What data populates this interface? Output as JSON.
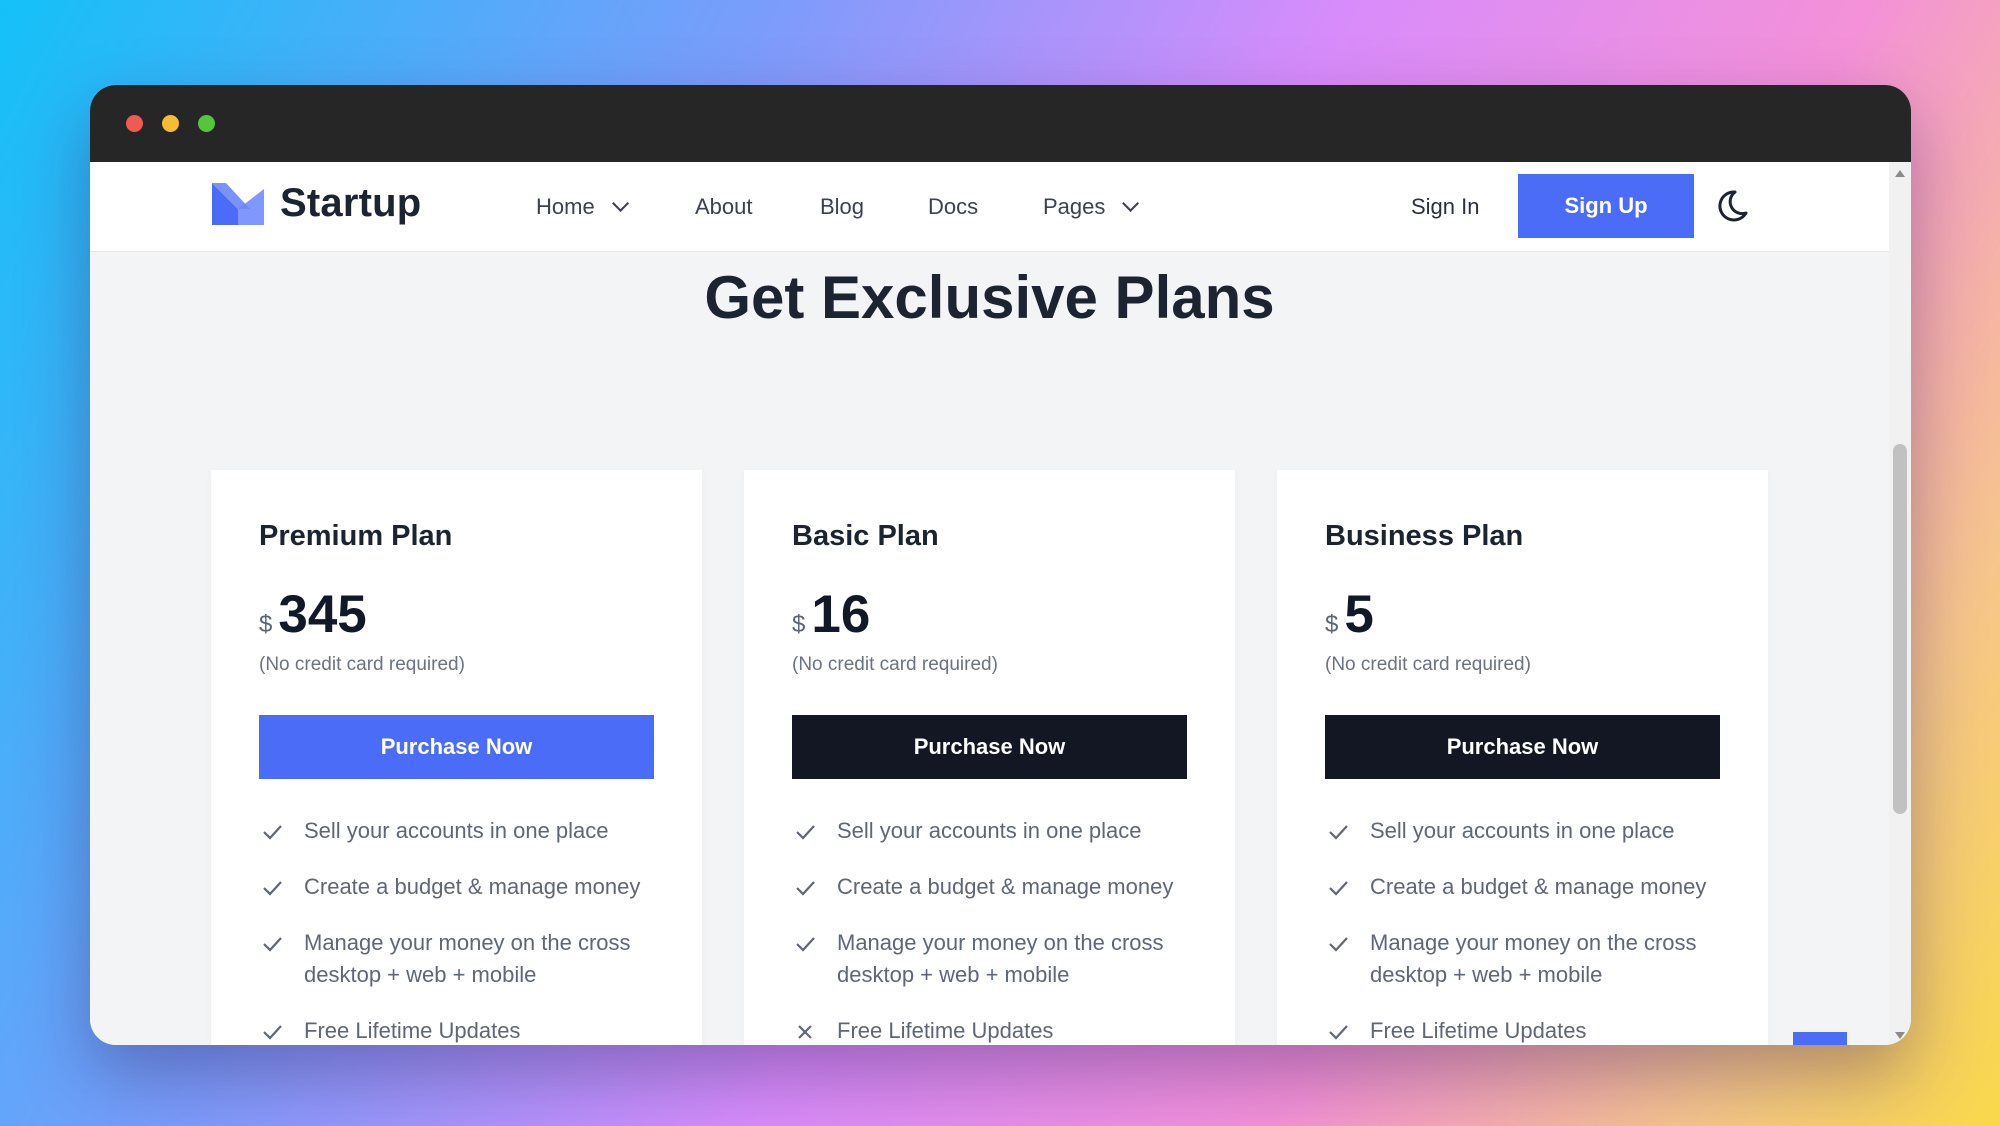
{
  "brand": {
    "name": "Startup",
    "accent": "#4a6cf7",
    "dark_button": "#121723"
  },
  "nav": {
    "items": [
      {
        "label": "Home",
        "dropdown": true
      },
      {
        "label": "About",
        "dropdown": false
      },
      {
        "label": "Blog",
        "dropdown": false
      },
      {
        "label": "Docs",
        "dropdown": false
      },
      {
        "label": "Pages",
        "dropdown": true
      }
    ],
    "sign_in": "Sign In",
    "sign_up": "Sign Up",
    "theme_icon": "moon-icon"
  },
  "section": {
    "title": "Get Exclusive Plans"
  },
  "plans": [
    {
      "name": "Premium Plan",
      "currency": "$",
      "price": "345",
      "note": "(No credit card required)",
      "button": "Purchase Now",
      "features": [
        {
          "text": "Sell your accounts in one place",
          "included": true
        },
        {
          "text": "Create a budget & manage money",
          "included": true
        },
        {
          "text": "Manage your money on the cross desktop + web + mobile",
          "included": true
        },
        {
          "text": "Free Lifetime Updates",
          "included": true
        }
      ]
    },
    {
      "name": "Basic Plan",
      "currency": "$",
      "price": "16",
      "note": "(No credit card required)",
      "button": "Purchase Now",
      "features": [
        {
          "text": "Sell your accounts in one place",
          "included": true
        },
        {
          "text": "Create a budget & manage money",
          "included": true
        },
        {
          "text": "Manage your money on the cross desktop + web + mobile",
          "included": true
        },
        {
          "text": "Free Lifetime Updates",
          "included": false
        }
      ]
    },
    {
      "name": "Business Plan",
      "currency": "$",
      "price": "5",
      "note": "(No credit card required)",
      "button": "Purchase Now",
      "features": [
        {
          "text": "Sell your accounts in one place",
          "included": true
        },
        {
          "text": "Create a budget & manage money",
          "included": true
        },
        {
          "text": "Manage your money on the cross desktop + web + mobile",
          "included": true
        },
        {
          "text": "Free Lifetime Updates",
          "included": true
        }
      ]
    }
  ]
}
